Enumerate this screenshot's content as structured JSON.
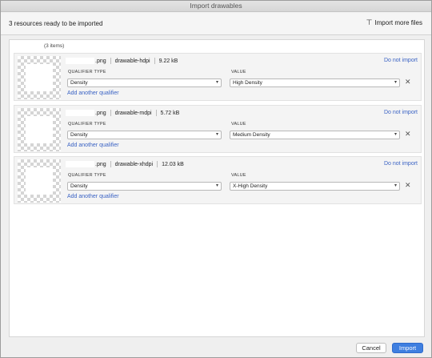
{
  "window": {
    "title": "Import drawables"
  },
  "header": {
    "count_text": "3 resources ready to be imported",
    "import_more_label": "Import more files",
    "import_more_icon": "filter-icon"
  },
  "list": {
    "items_count": "(3 items)"
  },
  "labels": {
    "qualifier_type": "QUALIFIER TYPE",
    "value": "VALUE",
    "do_not_import": "Do not import",
    "add_qualifier": "Add another qualifier",
    "remove_icon": "close-icon"
  },
  "resources": [
    {
      "ext": ".png",
      "folder": "drawable-hdpi",
      "size": "9.22 kB",
      "qualifier_type": "Density",
      "value": "High Density"
    },
    {
      "ext": ".png",
      "folder": "drawable-mdpi",
      "size": "5.72 kB",
      "qualifier_type": "Density",
      "value": "Medium Density"
    },
    {
      "ext": ".png",
      "folder": "drawable-xhdpi",
      "size": "12.03 kB",
      "qualifier_type": "Density",
      "value": "X-High Density"
    }
  ],
  "footer": {
    "cancel_label": "Cancel",
    "import_label": "Import"
  }
}
